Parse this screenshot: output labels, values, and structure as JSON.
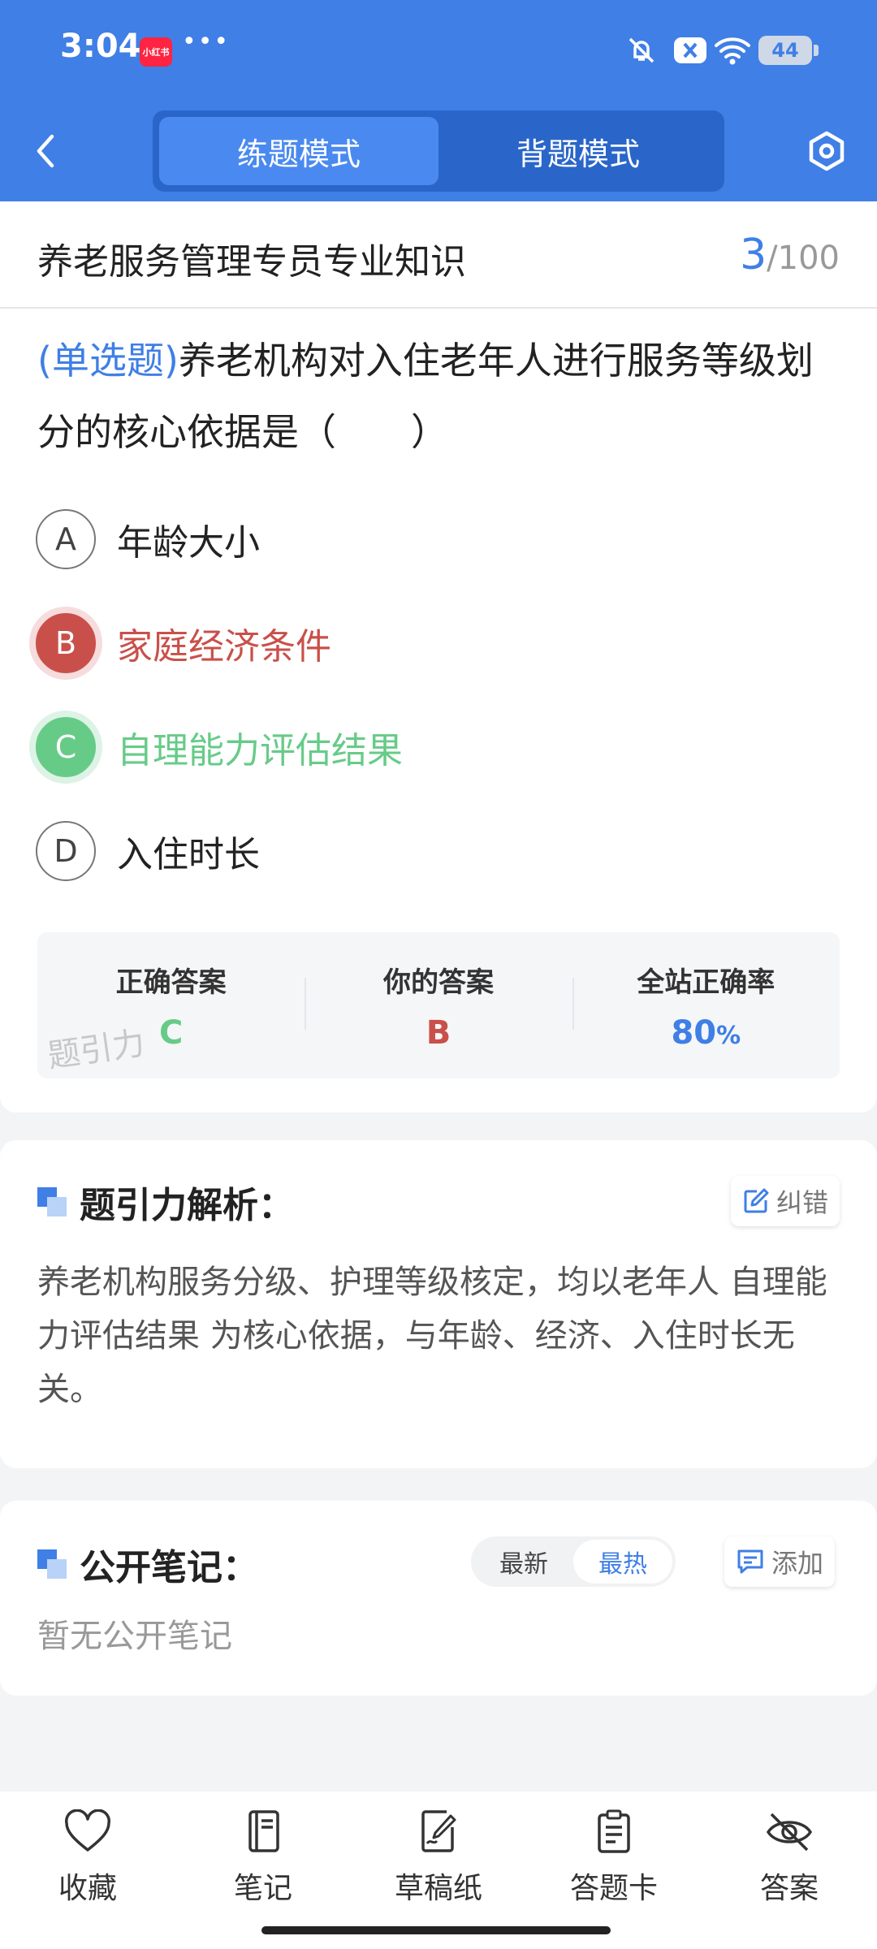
{
  "status_bar": {
    "time": "3:04",
    "app_badge": "小红书",
    "dots": "•••",
    "battery": "44",
    "icons": [
      "bell-off-icon",
      "close-box-icon",
      "wifi-icon",
      "battery-icon"
    ]
  },
  "header": {
    "tabs": [
      "练题模式",
      "背题模式"
    ],
    "active_tab": 0,
    "back_icon": "chevron-left-icon",
    "settings_icon": "hexagon-settings-icon"
  },
  "question": {
    "subject": "养老服务管理专员专业知识",
    "current": "3",
    "total": "/100",
    "type": "(单选题)",
    "text": "养老机构对入住老年人进行服务等级划分的核心依据是（　　）",
    "options": [
      {
        "letter": "A",
        "text": "年龄大小",
        "state": "normal"
      },
      {
        "letter": "B",
        "text": "家庭经济条件",
        "state": "wrong"
      },
      {
        "letter": "C",
        "text": "自理能力评估结果",
        "state": "correct"
      },
      {
        "letter": "D",
        "text": "入住时长",
        "state": "normal"
      }
    ]
  },
  "stats": {
    "correct_label": "正确答案",
    "correct_value": "C",
    "yours_label": "你的答案",
    "yours_value": "B",
    "rate_label": "全站正确率",
    "rate_value": "80",
    "rate_unit": "%",
    "watermark": "题引力"
  },
  "analysis": {
    "title": "题引力解析：",
    "report_label": "纠错",
    "text": "养老机构服务分级、护理等级核定，均以老年人 自理能力评估结果 为核心依据，与年龄、经济、入住时长无关。"
  },
  "notes": {
    "title": "公开笔记：",
    "sort": [
      "最新",
      "最热"
    ],
    "active_sort": 1,
    "add_label": "添加",
    "empty": "暂无公开笔记"
  },
  "bottom_bar": [
    {
      "label": "收藏",
      "icon": "heart-icon"
    },
    {
      "label": "笔记",
      "icon": "notebook-icon"
    },
    {
      "label": "草稿纸",
      "icon": "draft-icon"
    },
    {
      "label": "答题卡",
      "icon": "answer-sheet-icon"
    },
    {
      "label": "答案",
      "icon": "eye-off-icon"
    }
  ],
  "colors": {
    "primary": "#3f7fe6",
    "correct": "#67cb88",
    "wrong": "#c9504a"
  }
}
